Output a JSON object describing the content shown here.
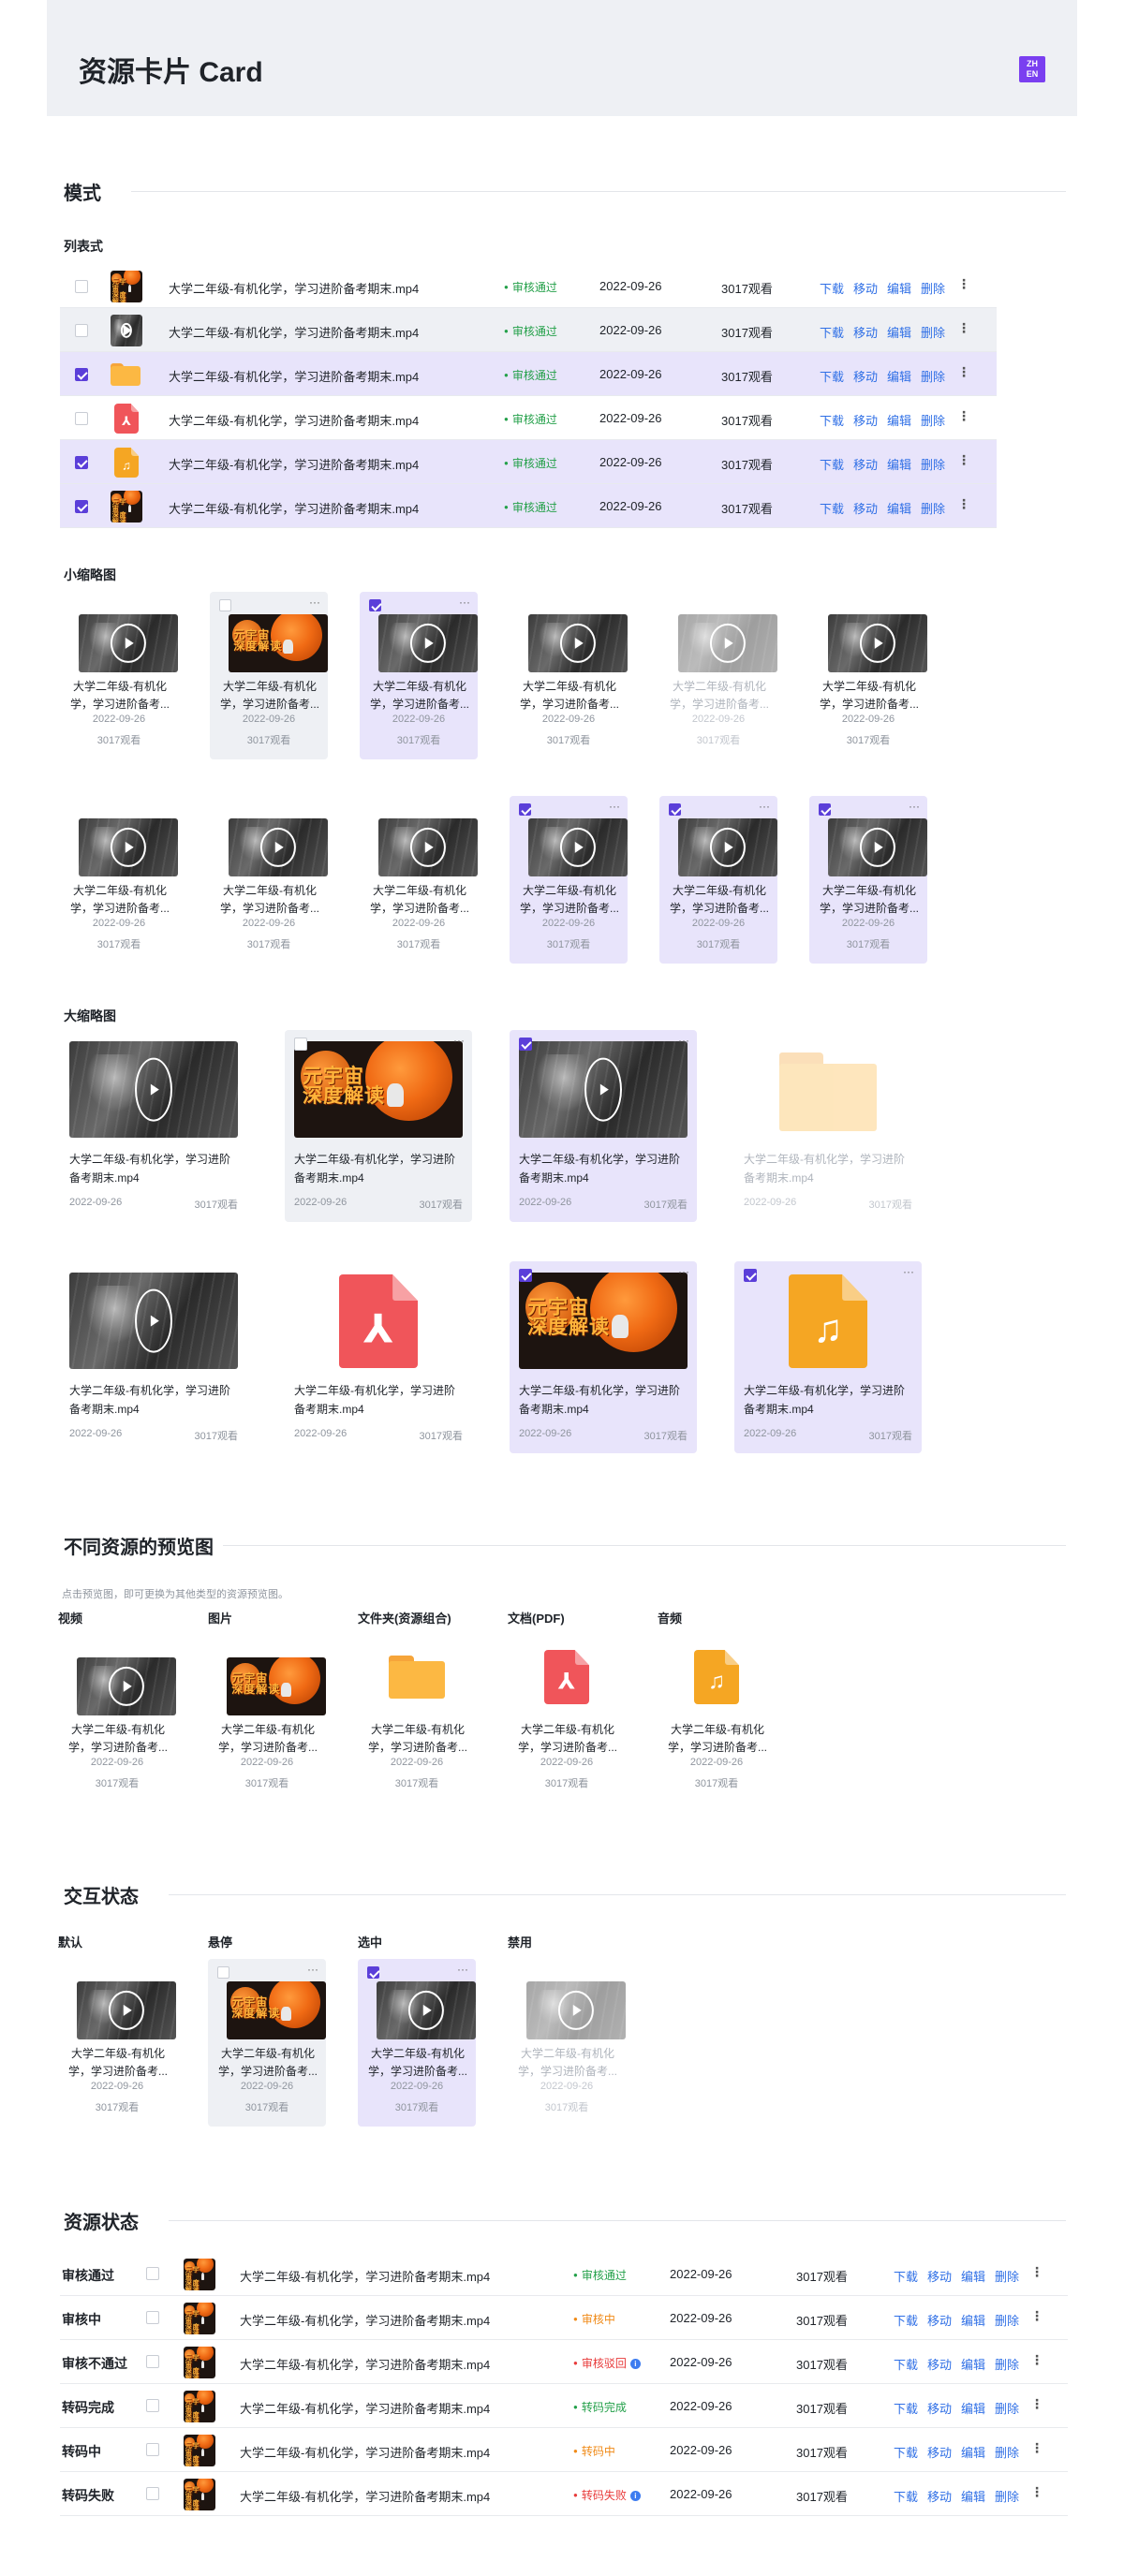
{
  "header": {
    "title": "资源卡片 Card",
    "lang_badge_top": "ZH",
    "lang_badge_bottom": "EN"
  },
  "sections": {
    "mode": "模式",
    "list_mode": "列表式",
    "small_thumb": "小缩略图",
    "large_thumb": "大缩略图",
    "preview": "不同资源的预览图",
    "preview_note": "点击预览图，即可更换为其他类型的资源预览图。",
    "interaction": "交互状态",
    "resource_state": "资源状态"
  },
  "file": {
    "name": "大学二年级-有机化学，学习进阶备考期末.mp4",
    "name_short_1": "大学二年级-有机化",
    "name_short_2": "学，学习进阶备考...",
    "name_big_1": "大学二年级-有机化学，学习进阶",
    "name_big_2": "备考期末.mp4",
    "date": "2022-09-26",
    "views": "3017观看"
  },
  "status_pass": "审核通过",
  "actions": {
    "download": "下载",
    "move": "移动",
    "edit": "编辑",
    "delete": "删除",
    "more": "⋮",
    "more_h": "···"
  },
  "preview_types": [
    "视频",
    "图片",
    "文件夹(资源组合)",
    "文档(PDF)",
    "音频"
  ],
  "interaction_states": [
    "默认",
    "悬停",
    "选中",
    "禁用"
  ],
  "image_text": "元宇宙 深度解读",
  "resource_states": [
    {
      "label": "审核通过",
      "status": "审核通过",
      "color": "green",
      "info": false
    },
    {
      "label": "审核中",
      "status": "审核中",
      "color": "orange",
      "info": false
    },
    {
      "label": "审核不通过",
      "status": "审核驳回",
      "color": "red",
      "info": true
    },
    {
      "label": "转码完成",
      "status": "转码完成",
      "color": "green",
      "info": false
    },
    {
      "label": "转码中",
      "status": "转码中",
      "color": "orange",
      "info": false
    },
    {
      "label": "转码失败",
      "status": "转码失败",
      "color": "red",
      "info": true
    }
  ],
  "colors": {
    "accent": "#5b3fd9",
    "link": "#2f6fe6",
    "success": "#23a049",
    "warning": "#f08a17",
    "danger": "#e83a3a",
    "selected_bg": "#e8e4fb",
    "hover_bg": "#eef0f4"
  },
  "icons": [
    "play-icon",
    "folder-icon",
    "pdf-icon",
    "audio-icon",
    "more-icon",
    "checkbox-icon",
    "info-icon"
  ]
}
